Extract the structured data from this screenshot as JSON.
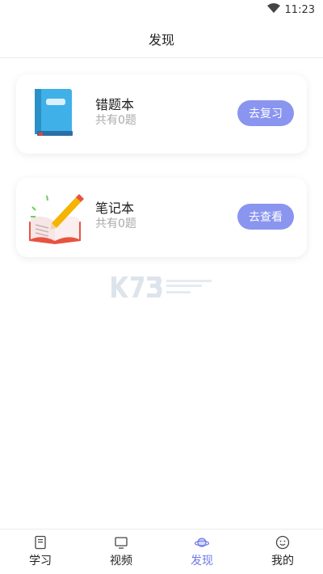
{
  "status_bar": {
    "time": "11:23"
  },
  "header": {
    "title": "发现"
  },
  "cards": [
    {
      "title": "错题本",
      "subtitle": "共有0题",
      "button": "去复习"
    },
    {
      "title": "笔记本",
      "subtitle": "共有0题",
      "button": "去查看"
    }
  ],
  "tabs": [
    {
      "label": "学习",
      "icon": "book-icon",
      "active": false
    },
    {
      "label": "视频",
      "icon": "monitor-icon",
      "active": false
    },
    {
      "label": "发现",
      "icon": "planet-icon",
      "active": true
    },
    {
      "label": "我的",
      "icon": "smiley-icon",
      "active": false
    }
  ],
  "colors": {
    "accent": "#6f7ae8",
    "button": "#8a95f0"
  }
}
